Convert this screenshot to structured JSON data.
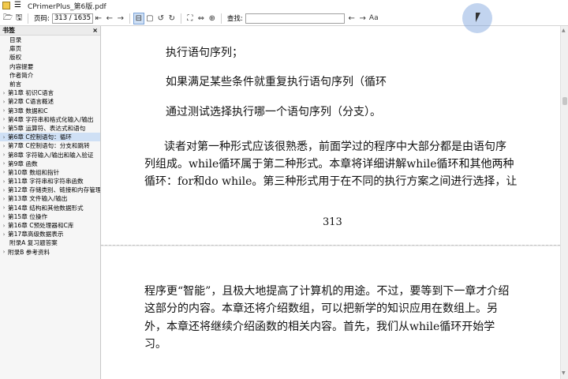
{
  "window": {
    "title": "CPrimerPlus_第6版.pdf"
  },
  "toolbar": {
    "page_label": "页码:",
    "page_value": "313 / 1635",
    "find_label": "查找:",
    "find_value": "",
    "nav_back": "←",
    "nav_forward": "→",
    "case_toggle": "Aa",
    "accent_color": "#cfe0f5"
  },
  "sidebar": {
    "title": "书签",
    "close": "×",
    "items": [
      {
        "label": "目录",
        "has_children": false
      },
      {
        "label": "扉页",
        "has_children": false
      },
      {
        "label": "版权",
        "has_children": false
      },
      {
        "label": "内容提要",
        "has_children": false
      },
      {
        "label": "作者简介",
        "has_children": false
      },
      {
        "label": "前言",
        "has_children": false
      },
      {
        "label": "第1章 初识C语言",
        "has_children": true
      },
      {
        "label": "第2章 C语言概述",
        "has_children": true
      },
      {
        "label": "第3章 数据和C",
        "has_children": true
      },
      {
        "label": "第4章 字符串和格式化输入/输出",
        "has_children": true
      },
      {
        "label": "第5章 运算符、表达式和语句",
        "has_children": true
      },
      {
        "label": "第6章 C控制语句：循环",
        "has_children": true,
        "selected": true
      },
      {
        "label": "第7章 C控制语句：分支和跳转",
        "has_children": true
      },
      {
        "label": "第8章 字符输入/输出和输入验证",
        "has_children": true
      },
      {
        "label": "第9章 函数",
        "has_children": true
      },
      {
        "label": "第10章 数组和指针",
        "has_children": true
      },
      {
        "label": "第11章 字符串和字符串函数",
        "has_children": true
      },
      {
        "label": "第12章 存储类别、链接和内存管理",
        "has_children": true
      },
      {
        "label": "第13章 文件输入/输出",
        "has_children": true
      },
      {
        "label": "第14章 结构和其他数据形式",
        "has_children": true
      },
      {
        "label": "第15章 位操作",
        "has_children": true
      },
      {
        "label": "第16章 C预处理器和C库",
        "has_children": true
      },
      {
        "label": "第17章高级数据表示",
        "has_children": true
      },
      {
        "label": "附录A 复习题答案",
        "has_children": false
      },
      {
        "label": "附录B 参考资料",
        "has_children": true
      }
    ]
  },
  "document": {
    "page1": {
      "p1": "执行语句序列；",
      "p2": "如果满足某些条件就重复执行语句序列（循环",
      "p3": "通过测试选择执行哪一个语句序列（分支）。",
      "p4_line1": "读者对第一种形式应该很熟悉，前面学过的程序中大部分都是由语句序",
      "p4_line2": "列组成。while循环属于第二种形式。本章将详细讲解while循环和其他两种",
      "p4_line3": "循环：for和do  while。第三种形式用于在不同的执行方案之间进行选择，让",
      "page_number": "313"
    },
    "page2": {
      "line1": "程序更“智能”，且极大地提高了计算机的用途。不过，要等到下一章才介绍",
      "line2": "这部分的内容。本章还将介绍数组，可以把新学的知识应用在数组上。另",
      "line3": "外，本章还将继续介绍函数的相关内容。首先，我们从while循环开始学",
      "line4": "习。"
    }
  }
}
